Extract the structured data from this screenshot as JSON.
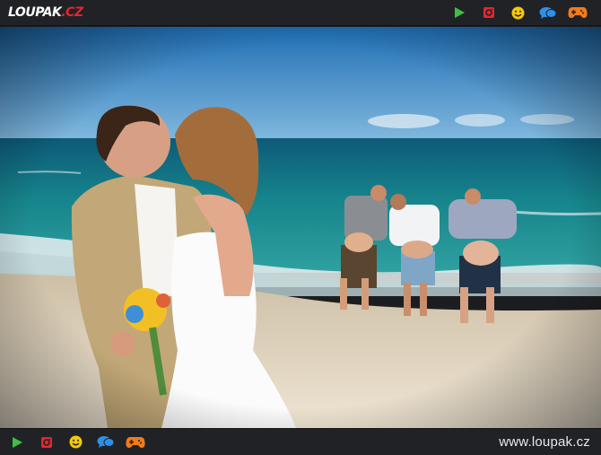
{
  "brand": {
    "logo_main": "LOUPAK",
    "logo_tld": ".CZ",
    "url": "www.loupak.cz"
  },
  "toolbar_icons": [
    {
      "name": "play-icon",
      "color": "#3fbf3f"
    },
    {
      "name": "instagram-icon",
      "color": "#e3262f"
    },
    {
      "name": "smiley-icon",
      "color": "#f2c80c"
    },
    {
      "name": "chat-icon",
      "color": "#2f8fe8"
    },
    {
      "name": "gamepad-icon",
      "color": "#f27a1a"
    }
  ]
}
